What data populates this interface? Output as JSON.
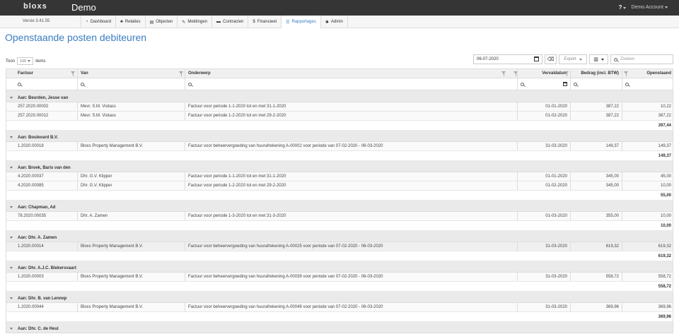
{
  "app": {
    "logo": "bloxs",
    "name": "Demo",
    "help": "?",
    "account": "Demo Account"
  },
  "nav": {
    "version": "Versie 3.41.55",
    "items": [
      {
        "icon": "dashboard-icon",
        "glyph": "◔",
        "label": "Dashboard"
      },
      {
        "icon": "relaties-icon",
        "glyph": "♣",
        "label": "Relaties"
      },
      {
        "icon": "objecten-icon",
        "glyph": "▤",
        "label": "Objecten"
      },
      {
        "icon": "wrench-icon",
        "glyph": "✎",
        "label": "Meldingen"
      },
      {
        "icon": "folder-icon",
        "glyph": "▬",
        "label": "Contracten"
      },
      {
        "icon": "dollar-icon",
        "glyph": "$",
        "label": "Financieel"
      },
      {
        "icon": "list-icon",
        "glyph": "☰",
        "label": "Rapportages"
      },
      {
        "icon": "gear-icon",
        "glyph": "✱",
        "label": "Admin"
      }
    ],
    "active_index": 6
  },
  "page": {
    "title": "Openstaande posten debiteuren"
  },
  "toolbar": {
    "toon_label": "Toon",
    "page_size": "100",
    "items_label": "items",
    "date": "06-07-2020",
    "export_label": "Export",
    "search_placeholder": "Zoeken"
  },
  "table": {
    "columns": {
      "factuur": "Factuur",
      "van": "Van",
      "onderwerp": "Onderwerp",
      "vervaldatum": "Vervaldatum",
      "bedrag": "Bedrag (incl. BTW)",
      "openstaand": "Openstaand"
    },
    "groups": [
      {
        "title": "Aan: Beurden, Jesse van",
        "rows": [
          {
            "factuur": "257.2020.00002",
            "van": "Mevr. S.M. Viotass",
            "onderwerp": "Factuur voor periode 1-1-2020 tot en met 31-1-2020",
            "vervaldatum": "01-01-2020",
            "bedrag": "387,22",
            "openstaand": "10,22"
          },
          {
            "factuur": "257.2020.00012",
            "van": "Mevr. S.M. Viotass",
            "onderwerp": "Factuur voor periode 1-2-2020 tot en met 29-2-2020",
            "vervaldatum": "01-02-2020",
            "bedrag": "387,22",
            "openstaand": "387,22"
          }
        ],
        "total": "397,44"
      },
      {
        "title": "Aan: Boulevard B.V.",
        "rows": [
          {
            "factuur": "1.2020.00018",
            "van": "Bloxs Property Management B.V.",
            "onderwerp": "Factuur voor beheervergoeding van huurafrekening A-00002 voor periode van 07-02-2020 - 06-03-2020",
            "vervaldatum": "31-03-2020",
            "bedrag": "149,37",
            "openstaand": "149,37"
          }
        ],
        "total": "149,37"
      },
      {
        "title": "Aan: Broek, Baris van den",
        "rows": [
          {
            "factuur": "4.2020.00037",
            "van": "Dhr. G.V. Klipper",
            "onderwerp": "Factuur voor periode 1-1-2020 tot en met 31-1-2020",
            "vervaldatum": "01-01-2020",
            "bedrag": "345,00",
            "openstaand": "45,00"
          },
          {
            "factuur": "4.2020.00085",
            "van": "Dhr. G.V. Klipper",
            "onderwerp": "Factuur voor periode 1-2-2020 tot en met 29-2-2020",
            "vervaldatum": "01-02-2020",
            "bedrag": "345,00",
            "openstaand": "10,00"
          }
        ],
        "total": "55,00"
      },
      {
        "title": "Aan: Chapman, Ad",
        "rows": [
          {
            "factuur": "78.2020.00035",
            "van": "Dhr. A. Zamen",
            "onderwerp": "Factuur voor periode 1-3-2020 tot en met 31-3-2020",
            "vervaldatum": "01-03-2020",
            "bedrag": "355,00",
            "openstaand": "10,00"
          }
        ],
        "total": "10,00"
      },
      {
        "title": "Aan: Dhr. A. Zamen",
        "rows": [
          {
            "factuur": "1.2020.00014",
            "van": "Bloxs Property Management B.V.",
            "onderwerp": "Factuur voor beheervergoeding van huurafrekening A-00025 voor periode van 07-02-2020 - 06-03-2020",
            "vervaldatum": "31-03-2020",
            "bedrag": "619,32",
            "openstaand": "619,32"
          }
        ],
        "total": "619,32"
      },
      {
        "title": "Aan: Dhr. A.J.C. Blekersvaart",
        "rows": [
          {
            "factuur": "1.2020.00003",
            "van": "Bloxs Property Management B.V.",
            "onderwerp": "Factuur voor beheervergoeding van huurafrekening A-00039 voor periode van 07-02-2020 - 06-03-2020",
            "vervaldatum": "31-03-2020",
            "bedrag": "558,72",
            "openstaand": "558,72"
          }
        ],
        "total": "558,72"
      },
      {
        "title": "Aan: Dhr. B. van Lennep",
        "rows": [
          {
            "factuur": "1.2020.00044",
            "van": "Bloxs Property Management B.V.",
            "onderwerp": "Factuur voor beheervergoeding van huurafrekening A-00048 voor periode van 07-02-2020 - 06-03-2020",
            "vervaldatum": "31-03-2020",
            "bedrag": "369,96",
            "openstaand": "369,96"
          }
        ],
        "total": "369,96"
      },
      {
        "title": "Aan: Dhr. C. de Heul",
        "rows": [],
        "total": ""
      }
    ]
  }
}
